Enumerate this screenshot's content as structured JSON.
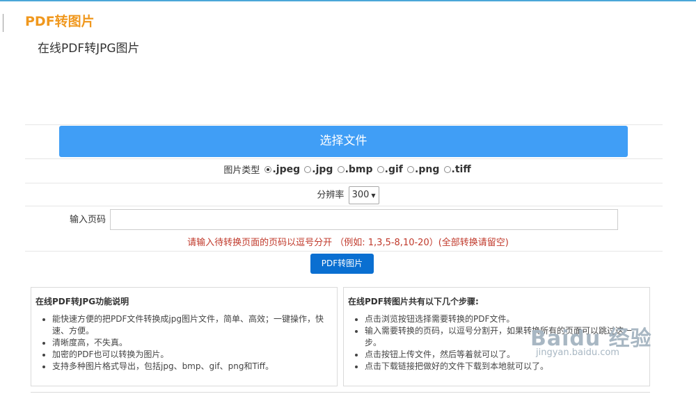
{
  "header": {
    "title": "PDF转图片",
    "subtitle": "在线PDF转JPG图片"
  },
  "choose_file": {
    "label": "选择文件"
  },
  "image_type": {
    "label": "图片类型",
    "options": [
      ".jpeg",
      ".jpg",
      ".bmp",
      ".gif",
      ".png",
      ".tiff"
    ],
    "selected": ".jpeg"
  },
  "resolution": {
    "label": "分辨率",
    "value": "300"
  },
  "page_input": {
    "label": "输入页码",
    "value": "",
    "placeholder": ""
  },
  "hint": "请输入待转换页面的页码以逗号分开 （例如: 1,3,5-8,10-20）(全部转换请留空)",
  "convert_button": {
    "label": "PDF转图片"
  },
  "features": {
    "title": "在线PDF转JPG功能说明",
    "items": [
      "能快速方便的把PDF文件转换成jpg图片文件，简单、高效；一键操作，快速、方便。",
      "清晰度高，不失真。",
      "加密的PDF也可以转换为图片。",
      "支持多种图片格式导出，包括jpg、bmp、gif、png和Tiff。"
    ]
  },
  "steps": {
    "title": "在线PDF转图片共有以下几个步骤:",
    "items": [
      "点击浏览按钮选择需要转换的PDF文件。",
      "输入需要转换的页码，以逗号分割开，如果转换所有的页面可以跳过这一步。",
      "点击按钮上传文件，然后等着就可以了。",
      "点击下载链接把做好的文件下载到本地就可以了。"
    ]
  },
  "watermark": {
    "brand": "Baidu 经验",
    "url": "jingyan.baidu.com"
  },
  "colors": {
    "title_orange": "#f0981e",
    "choose_button": "#409ef6",
    "convert_button": "#0a6fd1",
    "hint_red": "#c0392b"
  }
}
